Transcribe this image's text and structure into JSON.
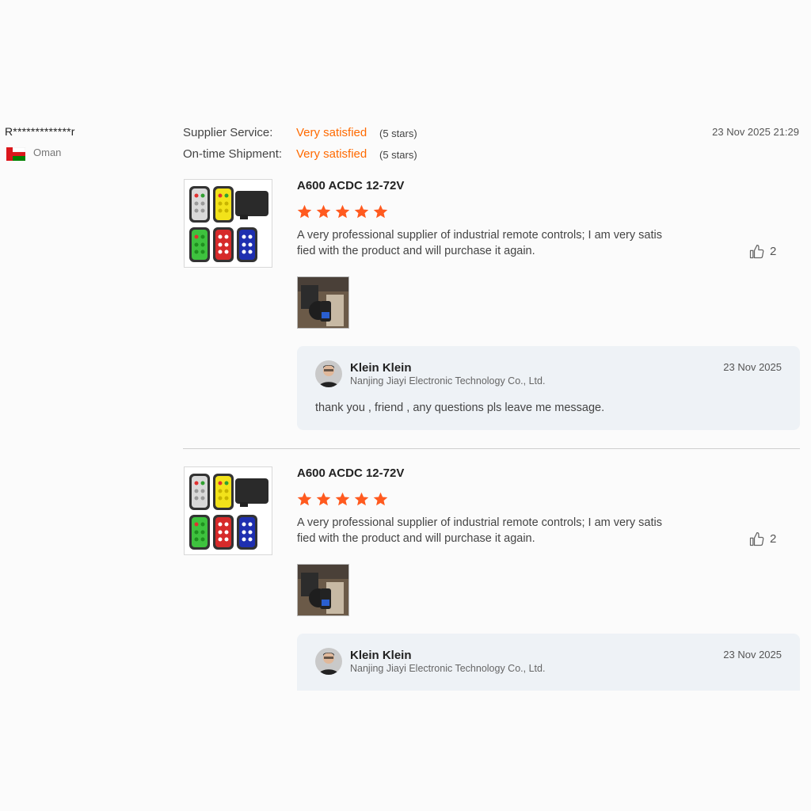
{
  "reviewer": {
    "name": "R*************r",
    "country": "Oman",
    "flag_icon": "oman-flag-icon"
  },
  "ratings": {
    "supplier_service_label": "Supplier Service:",
    "supplier_service_value": "Very satisfied",
    "supplier_service_stars": "(5 stars)",
    "shipment_label": "On-time Shipment:",
    "shipment_value": "Very satisfied",
    "shipment_stars": "(5 stars)"
  },
  "review_date": "23 Nov 2025 21:29",
  "reviews": [
    {
      "product_name": "A600 ACDC 12-72V",
      "stars": 5,
      "text_line1": "A very professional supplier of industrial remote controls; I am very satis",
      "text_line2": "fied with the product and will purchase it again.",
      "likes": "2",
      "reply": {
        "name": "Klein Klein",
        "company": "Nanjing Jiayi Electronic Technology Co., Ltd.",
        "date": "23 Nov 2025",
        "text": "thank you , friend , any questions pls leave me message."
      }
    },
    {
      "product_name": "A600 ACDC 12-72V",
      "stars": 5,
      "text_line1": "A very professional supplier of industrial remote controls; I am very satis",
      "text_line2": "fied with the product and will purchase it again.",
      "likes": "2",
      "reply": {
        "name": "Klein Klein",
        "company": "Nanjing Jiayi Electronic Technology Co., Ltd.",
        "date": "23 Nov 2025"
      }
    }
  ],
  "colors": {
    "accent": "#ff6a00",
    "star": "#ff5a1f",
    "reply_bg": "#eef2f6"
  }
}
